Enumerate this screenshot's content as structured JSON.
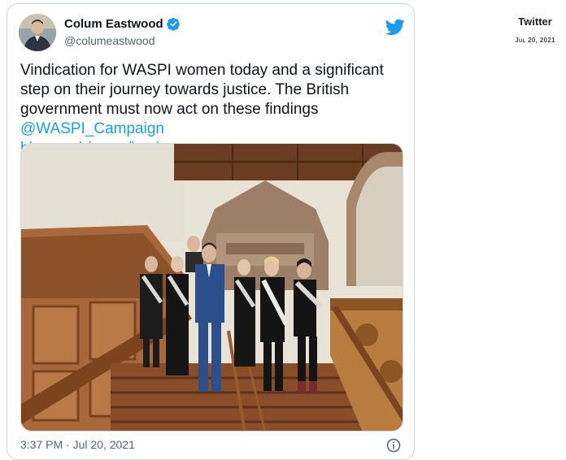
{
  "tweet": {
    "display_name": "Colum Eastwood",
    "handle": "@columeastwood",
    "text_main": "Vindication for WASPI women today and a significant step on their journey towards justice. The British government must now act on these findings ",
    "mention": "@WASPI_Campaign",
    "link": "bbc.co.uk/news/business-…",
    "timestamp": "3:37 PM · Jul 20, 2021",
    "icons": [
      "verified-badge-icon",
      "twitter-bird-icon",
      "info-icon"
    ],
    "colors": {
      "link": "#1d9bf0",
      "verified": "#1d9bf0",
      "text": "#0f1419",
      "muted": "#536471"
    }
  },
  "sidebar": {
    "source": "Twitter",
    "date": "Jul 20, 2021"
  }
}
